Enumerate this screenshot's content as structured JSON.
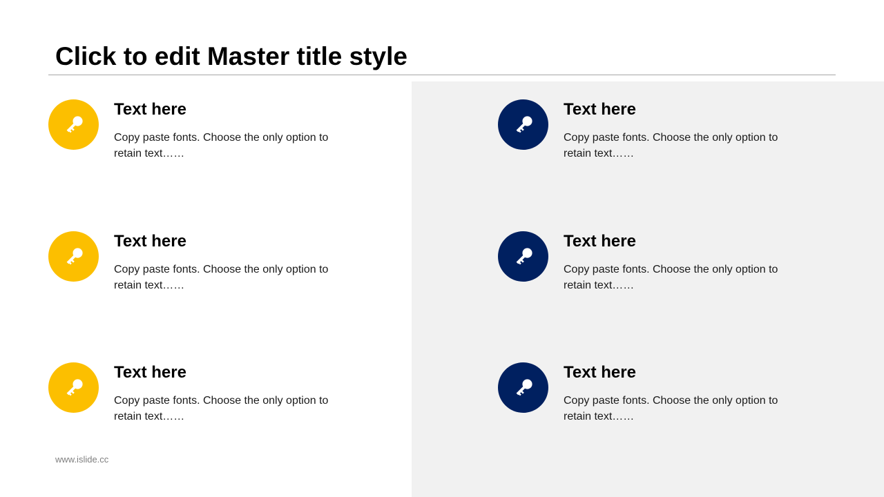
{
  "slide": {
    "title": "Click to edit Master title style",
    "footer": "www.islide.cc"
  },
  "colors": {
    "accent_yellow": "#fcbf00",
    "accent_navy": "#002060",
    "panel_gray": "#f1f1f1"
  },
  "items": [
    {
      "heading": "Text here",
      "body": "Copy paste fonts. Choose the only option to retain text……",
      "icon": "key-icon",
      "color": "#fcbf00"
    },
    {
      "heading": "Text here",
      "body": "Copy paste fonts. Choose the only option to retain text……",
      "icon": "key-icon",
      "color": "#fcbf00"
    },
    {
      "heading": "Text here",
      "body": "Copy paste fonts. Choose the only option to retain text……",
      "icon": "key-icon",
      "color": "#fcbf00"
    },
    {
      "heading": "Text here",
      "body": "Copy paste fonts. Choose the only option to retain text……",
      "icon": "key-icon",
      "color": "#002060"
    },
    {
      "heading": "Text here",
      "body": "Copy paste fonts. Choose the only option to retain text……",
      "icon": "key-icon",
      "color": "#002060"
    },
    {
      "heading": "Text here",
      "body": "Copy paste fonts. Choose the only option to retain text……",
      "icon": "key-icon",
      "color": "#002060"
    }
  ]
}
